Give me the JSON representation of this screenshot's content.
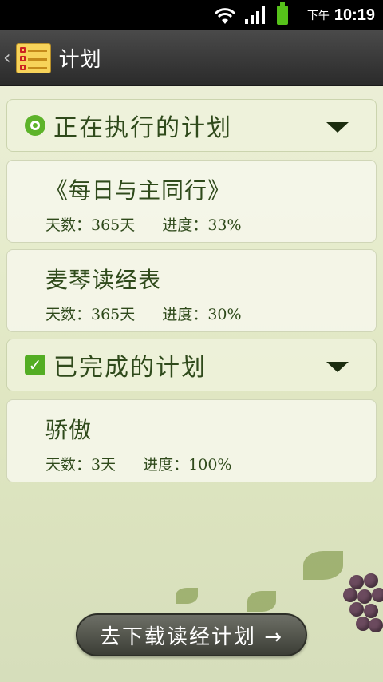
{
  "status_bar": {
    "ampm": "下午",
    "time": "10:19",
    "icons": [
      "wifi-icon",
      "signal-icon",
      "battery-icon"
    ]
  },
  "title_bar": {
    "back_glyph": "《",
    "title": "计划",
    "icon": "notepad-checklist-icon"
  },
  "sections": [
    {
      "title": "正在执行的计划",
      "icon": "status-circle-icon",
      "expand_icon": "dropdown-icon",
      "plans": [
        {
          "name": "《每日与主同行》",
          "days": "天数：365天",
          "progress": "进度：33%"
        },
        {
          "name": "麦琴读经表",
          "days": "天数：365天",
          "progress": "进度：30%"
        }
      ]
    },
    {
      "title": "已完成的计划",
      "icon": "check-square-icon",
      "expand_icon": "dropdown-icon",
      "plans": [
        {
          "name": "骄傲",
          "days": "天数：3天",
          "progress": "进度：100%"
        }
      ]
    }
  ],
  "footer": {
    "download_label": "去下载读经计划 →"
  },
  "colors": {
    "accent_green": "#5db32a",
    "text_green": "#2f4a1b",
    "titlebar": "#333333"
  }
}
